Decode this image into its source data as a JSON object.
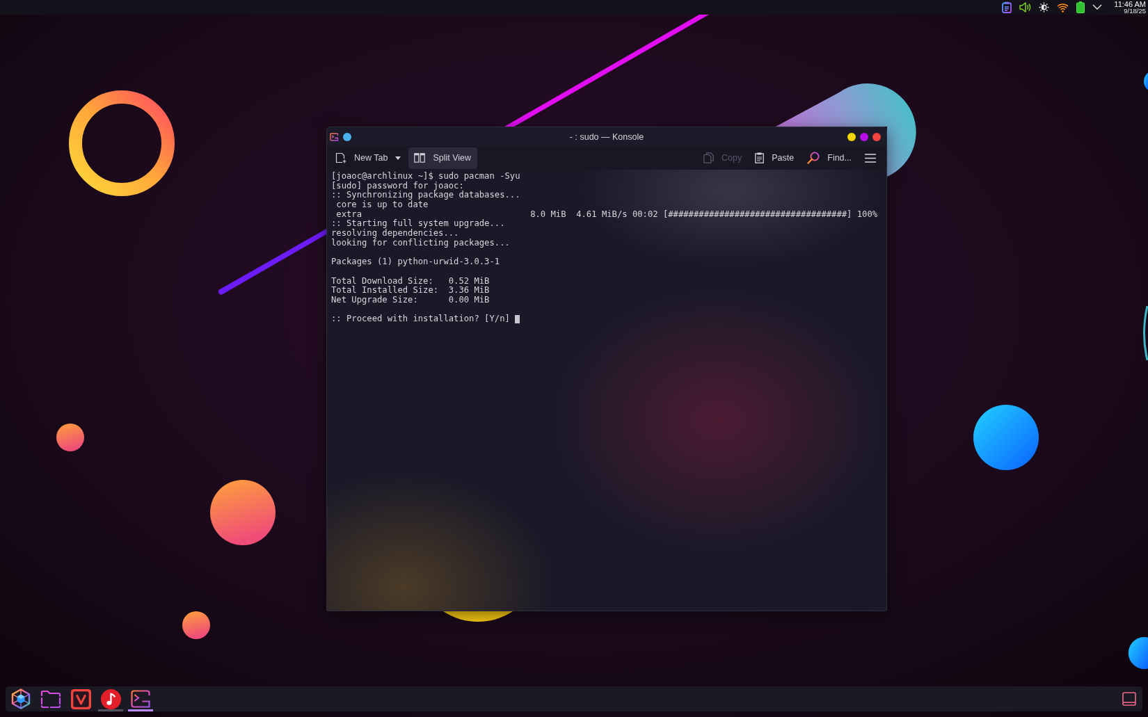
{
  "top_panel": {
    "clock_time": "11:46 AM",
    "clock_date": "9/18/25"
  },
  "window": {
    "title": "- : sudo — Konsole",
    "toolbar": {
      "left_buttons": [
        {
          "label": "New Tab",
          "has_menu": true,
          "hovered": false,
          "disabled": false
        },
        {
          "label": "Split View",
          "has_menu": false,
          "hovered": true,
          "disabled": false
        }
      ],
      "right_buttons": [
        {
          "label": "Copy",
          "hovered": false,
          "disabled": true
        },
        {
          "label": "Paste",
          "hovered": false,
          "disabled": false
        },
        {
          "label": "Find...",
          "hovered": false,
          "disabled": false
        }
      ]
    },
    "terminal": {
      "blocks": [
        [
          "[joaoc@archlinux ~]$ sudo pacman -Syu",
          "[sudo] password for joaoc:",
          ":: Synchronizing package databases...",
          " core is up to date",
          " extra                                 8.0 MiB  4.61 MiB/s 00:02 [###################################] 100%",
          ":: Starting full system upgrade...",
          "resolving dependencies...",
          "looking for conflicting packages..."
        ],
        [
          "Packages (1) python-urwid-3.0.3-1"
        ],
        [
          "Total Download Size:   0.52 MiB",
          "Total Installed Size:  3.36 MiB",
          "Net Upgrade Size:      0.00 MiB"
        ]
      ],
      "prompt": ":: Proceed with installation? [Y/n]",
      "cursor": true
    }
  },
  "taskbar": {
    "apps": [
      {
        "running": false,
        "active": false
      },
      {
        "running": false,
        "active": false
      },
      {
        "running": false,
        "active": false
      },
      {
        "running": true,
        "active": false
      },
      {
        "running": true,
        "active": true
      }
    ]
  }
}
